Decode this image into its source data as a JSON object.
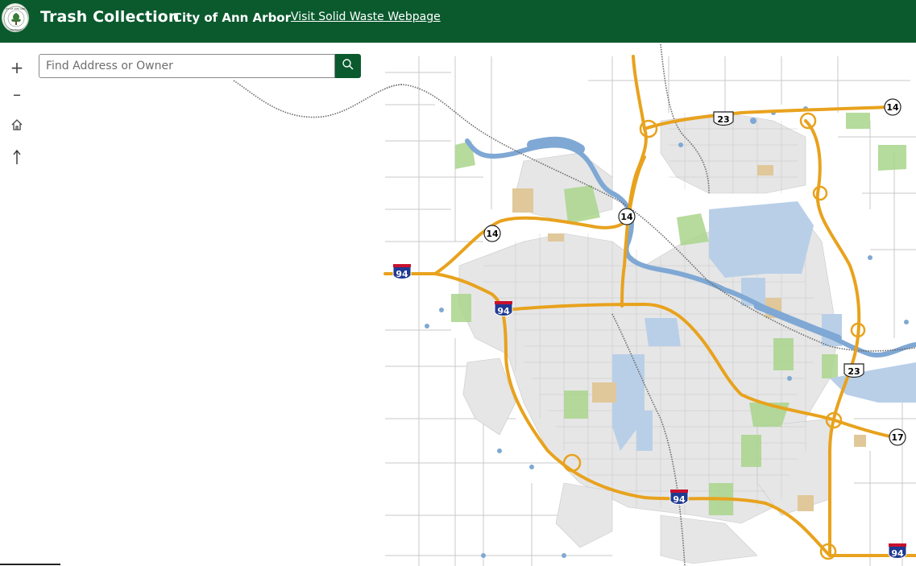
{
  "header": {
    "title": "Trash Collection",
    "org": "City of Ann Arbor",
    "link": "Visit Solid Waste Webpage",
    "logo_text": "CITY OF ANN ARBOR MICHIGAN",
    "background_color": "#0a5a2e"
  },
  "search": {
    "placeholder": "Find Address or Owner",
    "value": "",
    "button_icon": "search-icon"
  },
  "map_controls": {
    "zoom_in": "+",
    "zoom_out": "–",
    "home_icon": "home-icon",
    "compass_icon": "compass-arrow-icon"
  },
  "map": {
    "highway_labels": {
      "us23_north": "23",
      "us23_east": "23",
      "m14_ne": "14",
      "m14_center": "14",
      "m14_west": "14",
      "i94_west": "94",
      "i94_center": "94",
      "i94_south": "94",
      "i94_se": "94",
      "m17": "17"
    },
    "colors": {
      "freeway": "#e8a21d",
      "water": "#7fa8d4",
      "park": "#a9d58c",
      "institution": "#b9cfe8",
      "sand": "#e0c89a",
      "road": "#c2c2c2",
      "railroad": "#666666"
    }
  }
}
